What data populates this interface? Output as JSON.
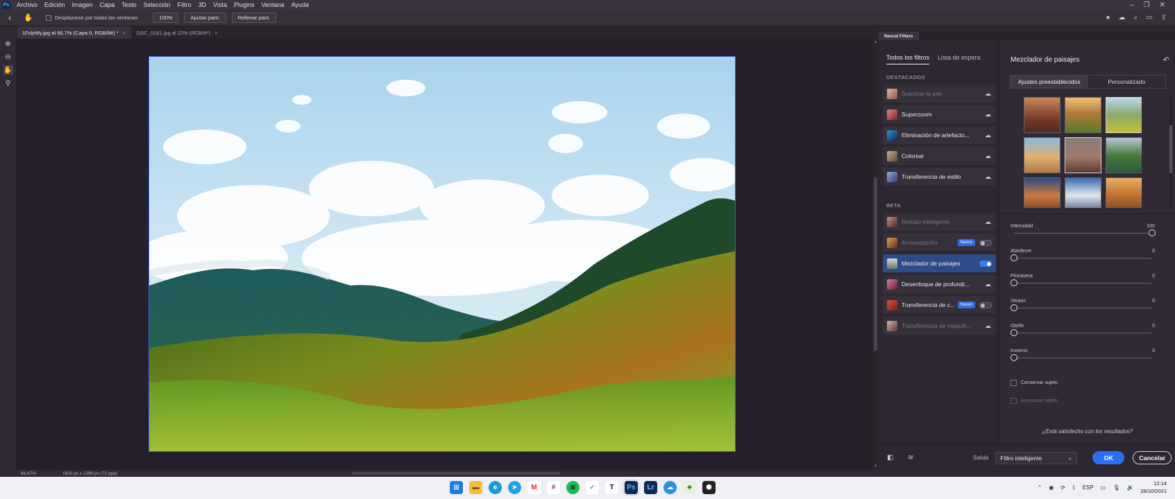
{
  "menubar": {
    "logo": "Ps",
    "items": [
      "Archivo",
      "Edición",
      "Imagen",
      "Capa",
      "Texto",
      "Selección",
      "Filtro",
      "3D",
      "Vista",
      "Plugins",
      "Ventana",
      "Ayuda"
    ]
  },
  "options_bar": {
    "scroll_all_label": "Desplazarse por todas las ventanas",
    "zoom_value": "100%",
    "fit_screen": "Ajustar pant.",
    "fill_screen": "Rellenar pant."
  },
  "doc_tabs": [
    {
      "label": "1FslyWy.jpg al 66,7% (Capa 0, RGB/8#) *"
    },
    {
      "label": "DSC_0161.jpg al 22% (RGB/8*)"
    }
  ],
  "status_bar": {
    "zoom": "66,67%",
    "dimensions": "1920 px x 1280 px (72 ppp)"
  },
  "neural_filters": {
    "panel_tab": "Neural Filters",
    "list_tabs": [
      "Todos los filtros",
      "Lista de espera"
    ],
    "section_featured": "DESTACADOS",
    "section_beta": "BETA",
    "featured": [
      {
        "label": "Suavizar la piel",
        "dim": true
      },
      {
        "label": "Superzoom",
        "dim": false
      },
      {
        "label": "Eliminación de artefacto...",
        "dim": false
      },
      {
        "label": "Colorear",
        "dim": false
      },
      {
        "label": "Transferencia de estilo",
        "dim": false
      }
    ],
    "beta": [
      {
        "label": "Retrato inteligente",
        "dim": true
      },
      {
        "label": "Armonización",
        "dim": true,
        "badge": "Nuevo"
      },
      {
        "label": "Mezclador de paisajes",
        "dim": false
      },
      {
        "label": "Desenfoque de profundi...",
        "dim": false
      },
      {
        "label": "Transferencia de c...",
        "dim": false,
        "badge": "Nuevo"
      },
      {
        "label": "Transferencia de maquill...",
        "dim": true
      }
    ],
    "detail": {
      "title": "Mezclador de paisajes",
      "seg_presets": "Ajustes preestablecidos",
      "seg_custom": "Personalizado",
      "sliders": [
        {
          "label": "Intensidad",
          "value": "100"
        },
        {
          "label": "Atardecer",
          "value": "0"
        },
        {
          "label": "Primavera",
          "value": "0"
        },
        {
          "label": "Verano",
          "value": "0"
        },
        {
          "label": "Otoño",
          "value": "0"
        },
        {
          "label": "Invierno",
          "value": "0"
        }
      ],
      "checkbox_preserve": "Conservar sujeto",
      "checkbox_harmonize": "Armonizar sujeto",
      "feedback": "¿Está satisfecho con los resultados?"
    },
    "bottom": {
      "output_label": "Salida",
      "output_value": "Filtro inteligente",
      "ok": "OK",
      "cancel": "Cancelar"
    }
  },
  "taskbar": {
    "lang": "ESP",
    "time": "12:14",
    "date": "28/10/2021"
  }
}
